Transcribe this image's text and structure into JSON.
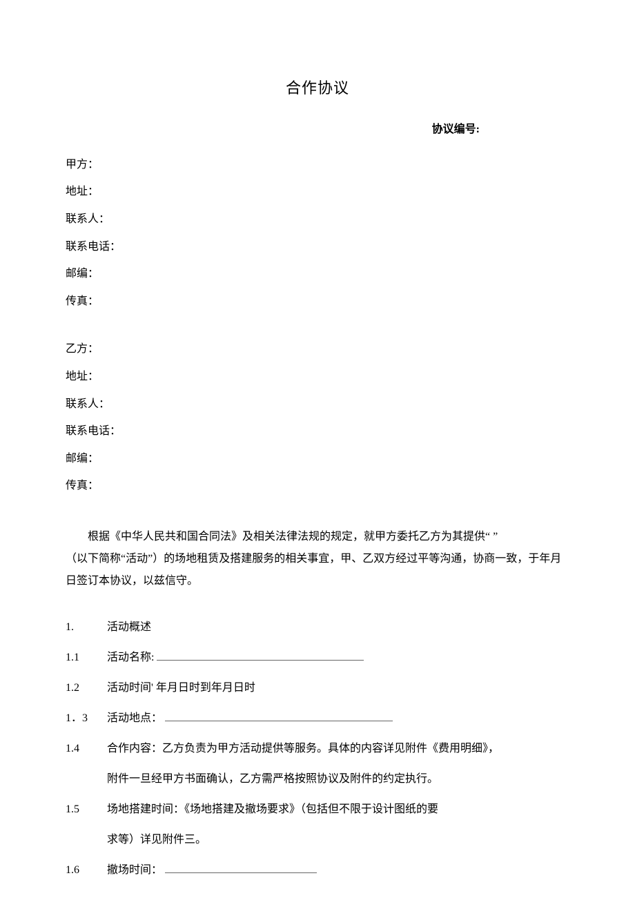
{
  "title": "合作协议",
  "contract_number_label": "协议编号:",
  "party_a": {
    "name_label": "甲方：",
    "address_label": "地址：",
    "contact_label": "联系人：",
    "phone_label": "联系电话：",
    "zip_label": "邮编：",
    "fax_label": "传真："
  },
  "party_b": {
    "name_label": "乙方：",
    "address_label": "地址：",
    "contact_label": "联系人：",
    "phone_label": "联系电话：",
    "zip_label": "邮编：",
    "fax_label": "传真："
  },
  "intro_line1": "根据《中华人民共和国合同法》及相关法律法规的规定，就甲方委托乙方为其提供“ ”",
  "intro_line2": "（以下简称“活动”）的场地租赁及搭建服务的相关事宜，甲、乙双方经过平等沟通，协商一致，于年月日签订本协议，以兹信守。",
  "sections": {
    "s1_num": "1.",
    "s1_text": "活动概述",
    "s11_num": "1.1",
    "s11_text": "活动名称:",
    "s12_num": "1.2",
    "s12_text": "活动时间' 年月日时到年月日时",
    "s13_num": "1．3",
    "s13_text": "活动地点：",
    "s14_num": "1.4",
    "s14_text": "合作内容：乙方负责为甲方活动提供等服务。具体的内容详见附件《费用明细》，",
    "s14_cont": "附件一旦经甲方书面确认，乙方需严格按照协议及附件的约定执行。",
    "s15_num": "1.5",
    "s15_text": "场地搭建时间：《场地搭建及撤场要求》（包括但不限于设计图纸的要",
    "s15_cont": "求等）详见附件三。",
    "s16_num": "1.6",
    "s16_text": "撤场时间："
  }
}
